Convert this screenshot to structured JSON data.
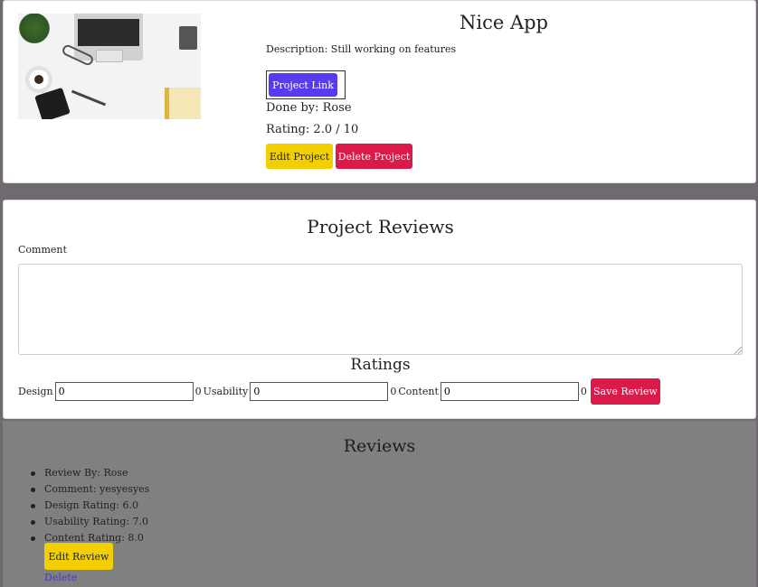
{
  "project": {
    "title": "Nice App",
    "description": "Description: Still working on features",
    "link_label": "Project Link",
    "done_by": "Done by: Rose",
    "rating": "Rating: 2.0 / 10",
    "edit_label": "Edit Project",
    "delete_label": "Delete Project"
  },
  "review_form": {
    "title": "Project Reviews",
    "comment_label": "Comment",
    "comment_value": "",
    "ratings_title": "Ratings",
    "fields": [
      {
        "label": "Design",
        "value": "0",
        "display": "0"
      },
      {
        "label": "Usability",
        "value": "0",
        "display": "0"
      },
      {
        "label": "Content",
        "value": "0",
        "display": "0"
      }
    ],
    "save_label": "Save Review"
  },
  "reviews": {
    "title": "Reviews",
    "items": [
      {
        "review_by": "Review By: Rose",
        "comment": "Comment: yesyesyes",
        "design": "Design Rating: 6.0",
        "usability": "Usability Rating: 7.0",
        "content": "Content Rating: 8.0",
        "edit_label": "Edit Review",
        "delete_label": "Delete"
      }
    ]
  },
  "colors": {
    "background": "#706a70",
    "primary": "#5a3af0",
    "warning": "#f2cf00",
    "danger": "#dc1a4a"
  }
}
